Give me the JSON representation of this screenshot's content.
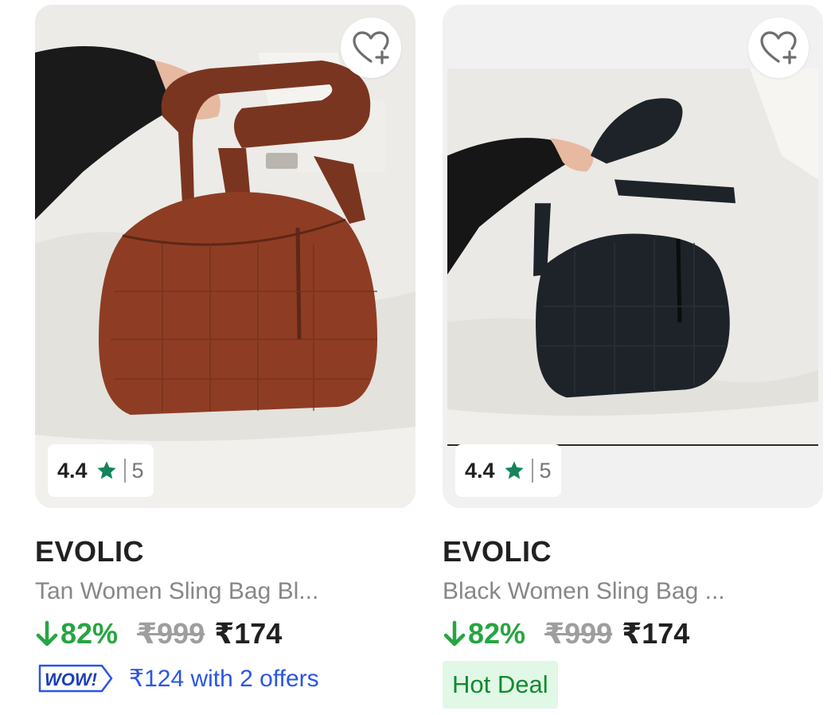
{
  "products": [
    {
      "brand": "EVOLIC",
      "title": "Tan Women Sling Bag Bl...",
      "rating": "4.4",
      "rating_count": "5",
      "discount": "82%",
      "mrp": "₹999",
      "price": "₹174",
      "wow_label": "WOW!",
      "offer_text": "₹124 with 2 offers",
      "bag_color": "#8e3d24"
    },
    {
      "brand": "EVOLIC",
      "title": "Black Women Sling Bag ...",
      "rating": "4.4",
      "rating_count": "5",
      "discount": "82%",
      "mrp": "₹999",
      "price": "₹174",
      "tag": "Hot Deal",
      "bag_color": "#1d2328"
    }
  ],
  "colors": {
    "discount_green": "#26a541",
    "star_green": "#14845a",
    "offer_blue": "#2a55e5",
    "hot_deal_bg": "#e1f8e6",
    "hot_deal_text": "#148a2f"
  }
}
